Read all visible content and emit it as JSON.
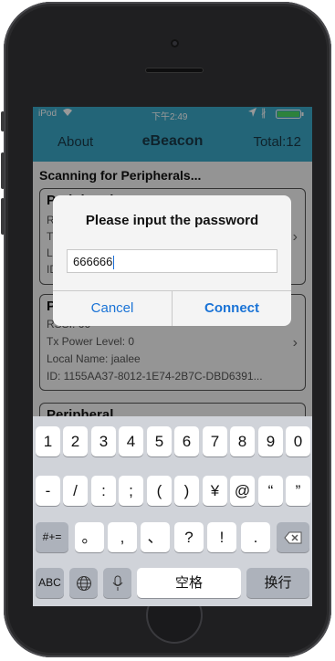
{
  "status_bar": {
    "carrier": "iPod",
    "time": "下午2:49",
    "icons": [
      "wifi-icon",
      "location-icon",
      "bluetooth-icon",
      "battery-icon"
    ]
  },
  "navbar": {
    "left": "About",
    "title": "eBeacon",
    "right": "Total:12"
  },
  "list": {
    "title": "Scanning for Peripherals...",
    "cards": [
      {
        "title": "Peripheral",
        "lines": [
          "R",
          "T",
          "L",
          "ID"
        ]
      },
      {
        "title": "P",
        "lines": [
          "RSSI: 66",
          "Tx Power Level: 0",
          "Local Name: jaalee",
          "ID: 1155AA37-8012-1E74-2B7C-DBD6391..."
        ]
      },
      {
        "title": "Peripheral",
        "lines": []
      }
    ]
  },
  "alert": {
    "title": "Please input the password",
    "input_value": "666666",
    "cancel": "Cancel",
    "connect": "Connect"
  },
  "keyboard": {
    "row1": [
      "1",
      "2",
      "3",
      "4",
      "5",
      "6",
      "7",
      "8",
      "9",
      "0"
    ],
    "row2": [
      "-",
      "/",
      ":",
      ";",
      "(",
      ")",
      "¥",
      "@",
      "“",
      "”"
    ],
    "row3_left": "#+=",
    "row3": [
      "。",
      ",",
      "、",
      "?",
      "!",
      "."
    ],
    "abc": "ABC",
    "space": "空格",
    "return": "换行"
  },
  "colors": {
    "accent": "#3ba9c9",
    "link": "#1a73d6"
  }
}
